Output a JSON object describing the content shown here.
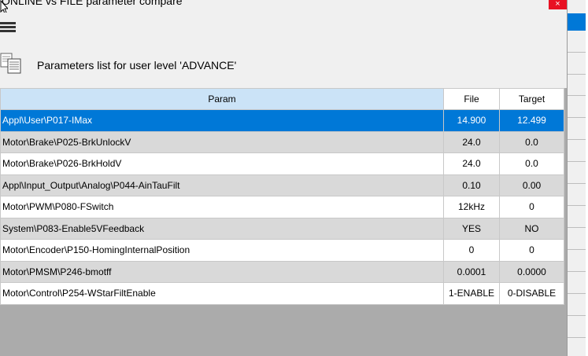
{
  "window": {
    "title": "ONLINE vs FILE parameter compare",
    "close_label": "×"
  },
  "header": {
    "title": "Parameters list for user level 'ADVANCE'"
  },
  "table": {
    "columns": [
      "Param",
      "File",
      "Target"
    ],
    "selected_row": 0,
    "rows": [
      {
        "param": "Appl\\User\\P017-IMax",
        "file": "14.900",
        "target": "12.499"
      },
      {
        "param": "Motor\\Brake\\P025-BrkUnlockV",
        "file": "24.0",
        "target": "0.0"
      },
      {
        "param": "Motor\\Brake\\P026-BrkHoldV",
        "file": "24.0",
        "target": "0.0"
      },
      {
        "param": "Appl\\Input_Output\\Analog\\P044-AinTauFilt",
        "file": "0.10",
        "target": "0.00"
      },
      {
        "param": "Motor\\PWM\\P080-FSwitch",
        "file": "12kHz",
        "target": "0"
      },
      {
        "param": "System\\P083-Enable5VFeedback",
        "file": "YES",
        "target": "NO"
      },
      {
        "param": "Motor\\Encoder\\P150-HomingInternalPosition",
        "file": "0",
        "target": "0"
      },
      {
        "param": "Motor\\PMSM\\P246-bmotff",
        "file": "0.0001",
        "target": "0.0000"
      },
      {
        "param": "Motor\\Control\\P254-WStarFiltEnable",
        "file": "1-ENABLE",
        "target": "0-DISABLE"
      }
    ]
  },
  "colors": {
    "selection": "#0078d7",
    "param_header": "#cbe3f7",
    "alt_row": "#d9d9d9",
    "grid_background": "#ababab",
    "close_button": "#e81123"
  }
}
